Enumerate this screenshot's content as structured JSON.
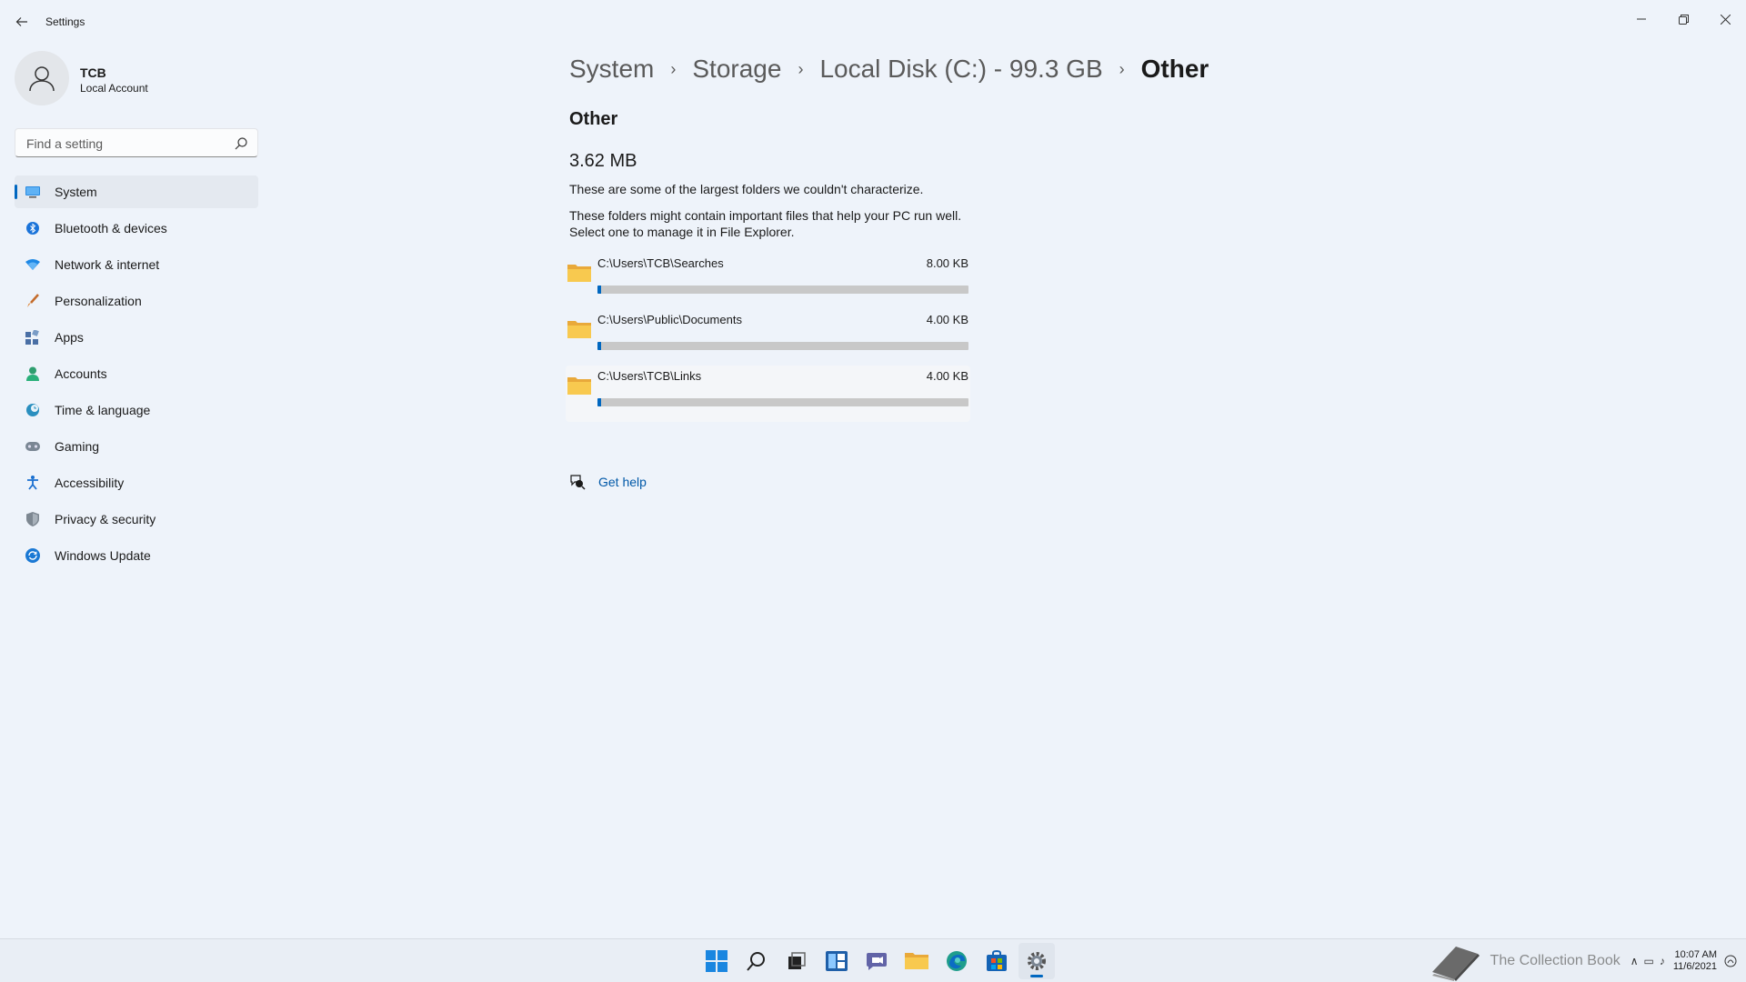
{
  "window": {
    "title": "Settings",
    "back_icon": "arrow-left-icon",
    "minimize_icon": "minimize-icon",
    "restore_icon": "restore-icon",
    "close_icon": "close-icon"
  },
  "profile": {
    "name": "TCB",
    "account_type": "Local Account"
  },
  "search": {
    "placeholder": "Find a setting",
    "value": ""
  },
  "sidebar": {
    "items": [
      {
        "label": "System",
        "icon": "monitor-icon",
        "active": true
      },
      {
        "label": "Bluetooth & devices",
        "icon": "bluetooth-icon"
      },
      {
        "label": "Network & internet",
        "icon": "wifi-icon"
      },
      {
        "label": "Personalization",
        "icon": "brush-icon"
      },
      {
        "label": "Apps",
        "icon": "apps-icon"
      },
      {
        "label": "Accounts",
        "icon": "person-icon"
      },
      {
        "label": "Time & language",
        "icon": "globe-clock-icon"
      },
      {
        "label": "Gaming",
        "icon": "gamepad-icon"
      },
      {
        "label": "Accessibility",
        "icon": "accessibility-icon"
      },
      {
        "label": "Privacy & security",
        "icon": "shield-icon"
      },
      {
        "label": "Windows Update",
        "icon": "update-icon"
      }
    ]
  },
  "breadcrumb": {
    "items": [
      "System",
      "Storage",
      "Local Disk (C:) - 99.3 GB"
    ],
    "current": "Other"
  },
  "main": {
    "section_title": "Other",
    "total_size": "3.62 MB",
    "description_1": "These are some of the largest folders we couldn't characterize.",
    "description_2_line1": "These folders might contain important files that help your PC run well.",
    "description_2_line2": "Select one to manage it in File Explorer.",
    "folders": [
      {
        "path": "C:\\Users\\TCB\\Searches",
        "size": "8.00 KB",
        "usage_fraction": 0.01
      },
      {
        "path": "C:\\Users\\Public\\Documents",
        "size": "4.00 KB",
        "usage_fraction": 0.01
      },
      {
        "path": "C:\\Users\\TCB\\Links",
        "size": "4.00 KB",
        "usage_fraction": 0.01
      }
    ],
    "get_help": "Get help"
  },
  "taskbar": {
    "apps": [
      {
        "name": "start-icon"
      },
      {
        "name": "search-icon"
      },
      {
        "name": "task-view-icon"
      },
      {
        "name": "widgets-icon"
      },
      {
        "name": "chat-icon"
      },
      {
        "name": "file-explorer-icon"
      },
      {
        "name": "edge-icon"
      },
      {
        "name": "store-icon"
      },
      {
        "name": "settings-icon",
        "active": true
      }
    ],
    "watermark": "The Collection Book",
    "time": "10:07 AM",
    "date": "11/6/2021"
  },
  "colors": {
    "accent": "#0067c0",
    "background": "#eef3fa",
    "folder": "#f5c242"
  }
}
